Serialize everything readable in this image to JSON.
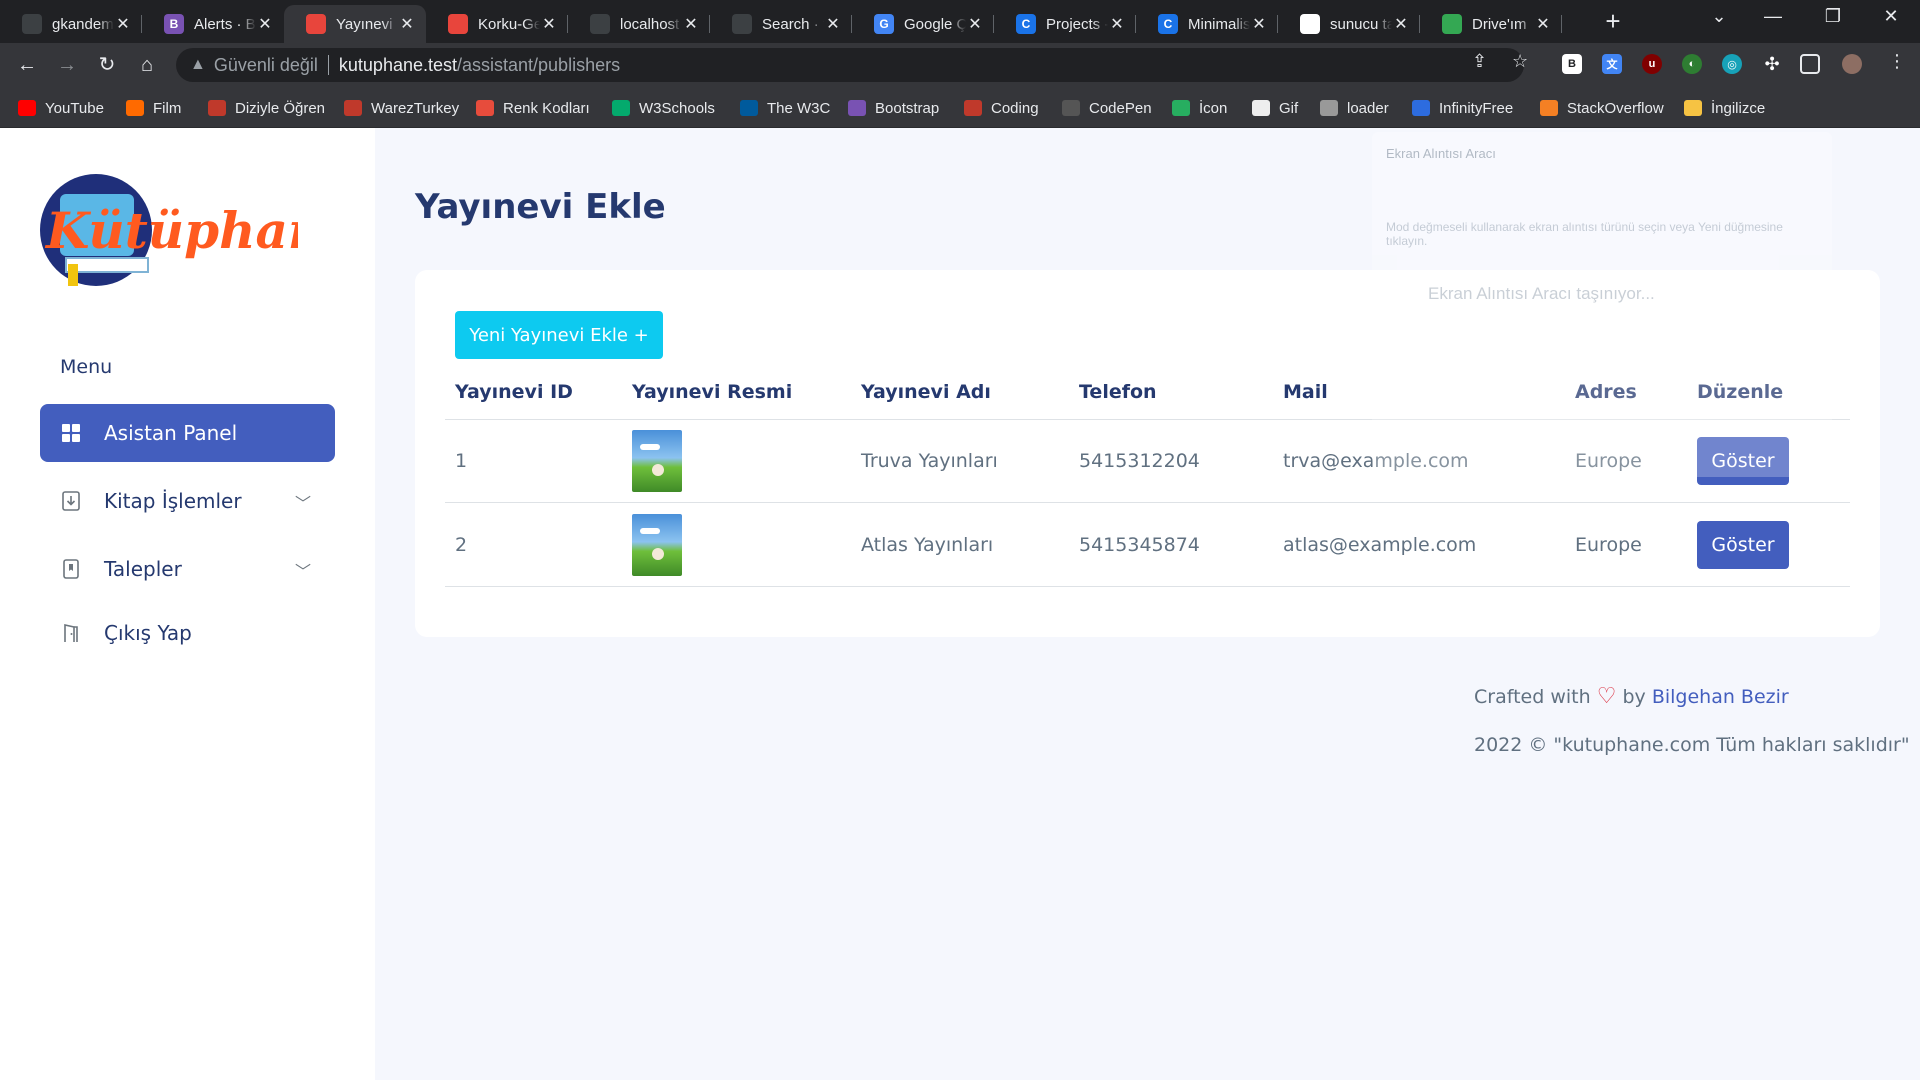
{
  "browser": {
    "tabs": [
      {
        "title": "gkandem",
        "fav_color": "#3c4043",
        "fav_text": ""
      },
      {
        "title": "Alerts · Bo",
        "fav_color": "#7952b3",
        "fav_text": "B"
      },
      {
        "title": "Yayınevi E",
        "fav_color": "#e8453c",
        "fav_text": ""
      },
      {
        "title": "Korku-Ge",
        "fav_color": "#e8453c",
        "fav_text": ""
      },
      {
        "title": "localhost",
        "fav_color": "#3c4043",
        "fav_text": ""
      },
      {
        "title": "Search · f",
        "fav_color": "#3c4043",
        "fav_text": ""
      },
      {
        "title": "Google Ç",
        "fav_color": "#4285f4",
        "fav_text": "G"
      },
      {
        "title": "Projects -",
        "fav_color": "#1a73e8",
        "fav_text": "C"
      },
      {
        "title": "Minimalis",
        "fav_color": "#1a73e8",
        "fav_text": "C"
      },
      {
        "title": "sunucu ta",
        "fav_color": "#ffffff",
        "fav_text": ""
      },
      {
        "title": "Drive'ım",
        "fav_color": "#34a853",
        "fav_text": ""
      }
    ],
    "active_tab_index": 2,
    "address": {
      "security_label": "Güvenli değil",
      "host": "kutuphane.test",
      "path": "/assistant/publishers"
    },
    "bookmarks": [
      {
        "label": "YouTube",
        "color": "#ff0000"
      },
      {
        "label": "Film",
        "color": "#ff6a00"
      },
      {
        "label": "Diziyle Öğren",
        "color": "#c0392b"
      },
      {
        "label": "WarezTurkey",
        "color": "#c0392b"
      },
      {
        "label": "Renk Kodları",
        "color": "#e74c3c"
      },
      {
        "label": "W3Schools",
        "color": "#04aa6d"
      },
      {
        "label": "The W3C",
        "color": "#005a9c"
      },
      {
        "label": "Bootstrap",
        "color": "#7952b3"
      },
      {
        "label": "Coding",
        "color": "#c0392b"
      },
      {
        "label": "CodePen",
        "color": "#555555"
      },
      {
        "label": "İcon",
        "color": "#27ae60"
      },
      {
        "label": "Gif",
        "color": "#eeeeee"
      },
      {
        "label": "loader",
        "color": "#999999"
      },
      {
        "label": "InfinityFree",
        "color": "#2d6cdf"
      },
      {
        "label": "StackOverflow",
        "color": "#f48024"
      },
      {
        "label": "İngilizce",
        "color": "#f6c343"
      }
    ]
  },
  "sidebar": {
    "logo_text": "Kütüphane",
    "menu_title": "Menu",
    "items": [
      {
        "label": "Asistan Panel",
        "icon": "grid-icon",
        "active": true
      },
      {
        "label": "Kitap İşlemler",
        "icon": "book-download-icon",
        "active": false,
        "has_submenu": true
      },
      {
        "label": "Talepler",
        "icon": "bookmark-icon",
        "active": false,
        "has_submenu": true
      },
      {
        "label": "Çıkış Yap",
        "icon": "door-icon",
        "active": false
      }
    ]
  },
  "main": {
    "title": "Yayınevi Ekle",
    "add_button_label": "Yeni Yayınevi Ekle +",
    "table": {
      "headers": [
        "Yayınevi ID",
        "Yayınevi Resmi",
        "Yayınevi Adı",
        "Telefon",
        "Mail",
        "Adres",
        "Düzenle"
      ],
      "rows": [
        {
          "id": "1",
          "name": "Truva Yayınları",
          "phone": "5415312204",
          "mail": "trva@example.com",
          "address": "Europe",
          "action": "Göster"
        },
        {
          "id": "2",
          "name": "Atlas Yayınları",
          "phone": "5415345874",
          "mail": "atlas@example.com",
          "address": "Europe",
          "action": "Göster"
        }
      ]
    }
  },
  "footer": {
    "crafted_prefix": "Crafted with",
    "crafted_by": "by",
    "author": "Bilgehan Bezir",
    "copyright": "2022 © \"kutuphane.com Tüm hakları saklıdır\""
  },
  "overlay": {
    "title": "Ekran Alıntısı Aracı",
    "hint": "Mod değmeseli kullanarak ekran alıntısı türünü seçin veya Yeni düğmesine tıklayın.",
    "moving": "Ekran Alıntısı Aracı taşınıyor..."
  },
  "colors": {
    "primary": "#435ebe",
    "info": "#0dcaf0",
    "heading": "#25396f",
    "text": "#607080",
    "page_bg": "#f5f7fd"
  }
}
